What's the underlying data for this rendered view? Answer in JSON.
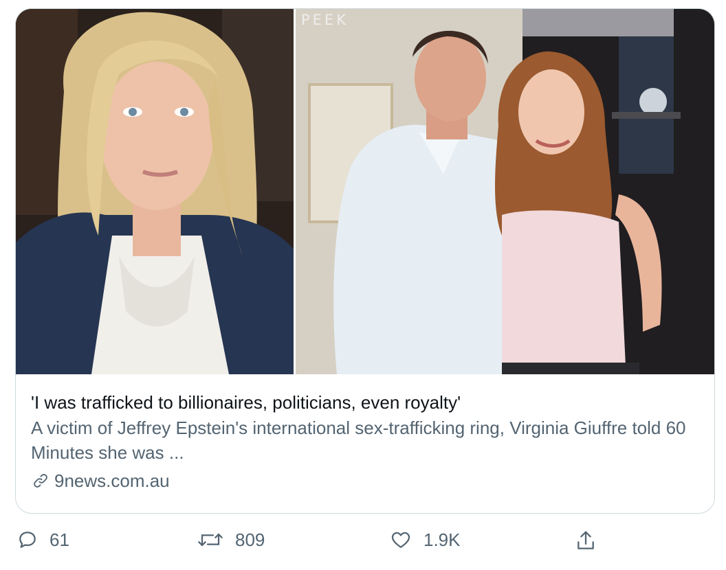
{
  "media": {
    "left_photo_alt": "Photo of a blonde woman in a navy blazer and white blouse",
    "right_photo_badge": "PEEK",
    "right_photo_alt": "Photo of a man in a white shirt standing beside a young woman"
  },
  "card": {
    "headline": "'I was trafficked to billionaires, politicians, even royalty'",
    "summary": "A victim of Jeffrey Epstein's international sex-trafficking ring, Virginia Giuffre told 60 Minutes she was ...",
    "domain": "9news.com.au"
  },
  "actions": {
    "replies": "61",
    "retweets": "809",
    "likes": "1.9K"
  },
  "colors": {
    "text_primary": "#0f1419",
    "text_secondary": "#536471",
    "border": "#cfd9de"
  },
  "icons": {
    "link": "link-icon",
    "reply": "reply-icon",
    "retweet": "retweet-icon",
    "like": "heart-icon",
    "share": "share-icon"
  }
}
